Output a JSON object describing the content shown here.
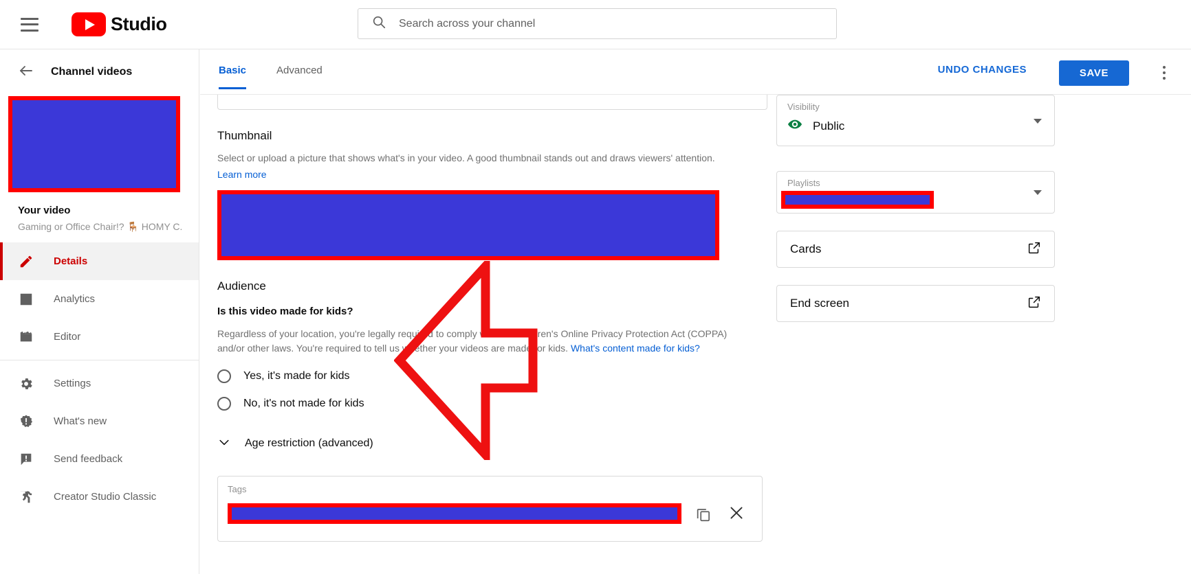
{
  "header": {
    "menu_icon": "hamburger-menu-icon",
    "logo_text": "Studio",
    "logo_icon": "youtube-play-icon",
    "search": {
      "icon": "search-icon",
      "placeholder": "Search across your channel",
      "value": ""
    }
  },
  "sidebar": {
    "back_icon": "back-arrow-icon",
    "title": "Channel videos",
    "thumbnail": {
      "name": "video-thumbnail-redacted",
      "redacted": true
    },
    "video_title": "Your video",
    "video_subtitle": "Gaming or Office Chair!? 🪑 HOMY C...",
    "items": [
      {
        "label": "Details",
        "icon": "pencil-icon",
        "active": true
      },
      {
        "label": "Analytics",
        "icon": "bar-chart-icon",
        "active": false
      },
      {
        "label": "Editor",
        "icon": "clapperboard-icon",
        "active": false
      },
      {
        "label": "Settings",
        "icon": "gear-icon",
        "active": false
      },
      {
        "label": "What's new",
        "icon": "alert-badge-icon",
        "active": false
      },
      {
        "label": "Send feedback",
        "icon": "feedback-bubble-icon",
        "active": false
      },
      {
        "label": "Creator Studio Classic",
        "icon": "running-person-icon",
        "active": false
      }
    ]
  },
  "toolbar": {
    "tabs": [
      {
        "label": "Basic",
        "active": true
      },
      {
        "label": "Advanced",
        "active": false
      }
    ],
    "undo_label": "UNDO CHANGES",
    "save_label": "SAVE",
    "kebab_icon": "more-vertical-icon"
  },
  "main": {
    "thumbnail": {
      "heading": "Thumbnail",
      "description": "Select or upload a picture that shows what's in your video. A good thumbnail stands out and draws viewers' attention.",
      "learn_more": "Learn more",
      "image_redacted": true
    },
    "audience": {
      "heading": "Audience",
      "question": "Is this video made for kids?",
      "coppa_text_part1": "Regardless of your location, you're legally required to comply with the Children's Online Privacy Protection Act (COPPA) and/or other laws. You're required to tell us whether your videos are made for kids. ",
      "coppa_link": "What's content made for kids?",
      "options": [
        {
          "label": "Yes, it's made for kids",
          "selected": false
        },
        {
          "label": "No, it's not made for kids",
          "selected": false
        }
      ],
      "age_restriction_label": "Age restriction (advanced)",
      "age_restriction_icon": "chevron-down-icon"
    },
    "tags": {
      "label": "Tags",
      "value_redacted": true,
      "copy_icon": "copy-icon",
      "clear_icon": "close-icon"
    }
  },
  "right_panel": {
    "visibility": {
      "label": "Visibility",
      "value": "Public",
      "icon": "eye-icon",
      "icon_color": "#0b8043",
      "dropdown_icon": "chevron-down-icon"
    },
    "playlists": {
      "label": "Playlists",
      "value_redacted": true,
      "dropdown_icon": "chevron-down-icon"
    },
    "cards": {
      "label": "Cards",
      "icon": "external-link-icon"
    },
    "end_screen": {
      "label": "End screen",
      "icon": "external-link-icon"
    }
  },
  "annotations": {
    "arrow": {
      "name": "red-arrow-pointing-left",
      "color": "#ee1111",
      "direction": "left"
    },
    "redaction_color": "#3b38d8",
    "redaction_border_color": "#ff0000"
  }
}
